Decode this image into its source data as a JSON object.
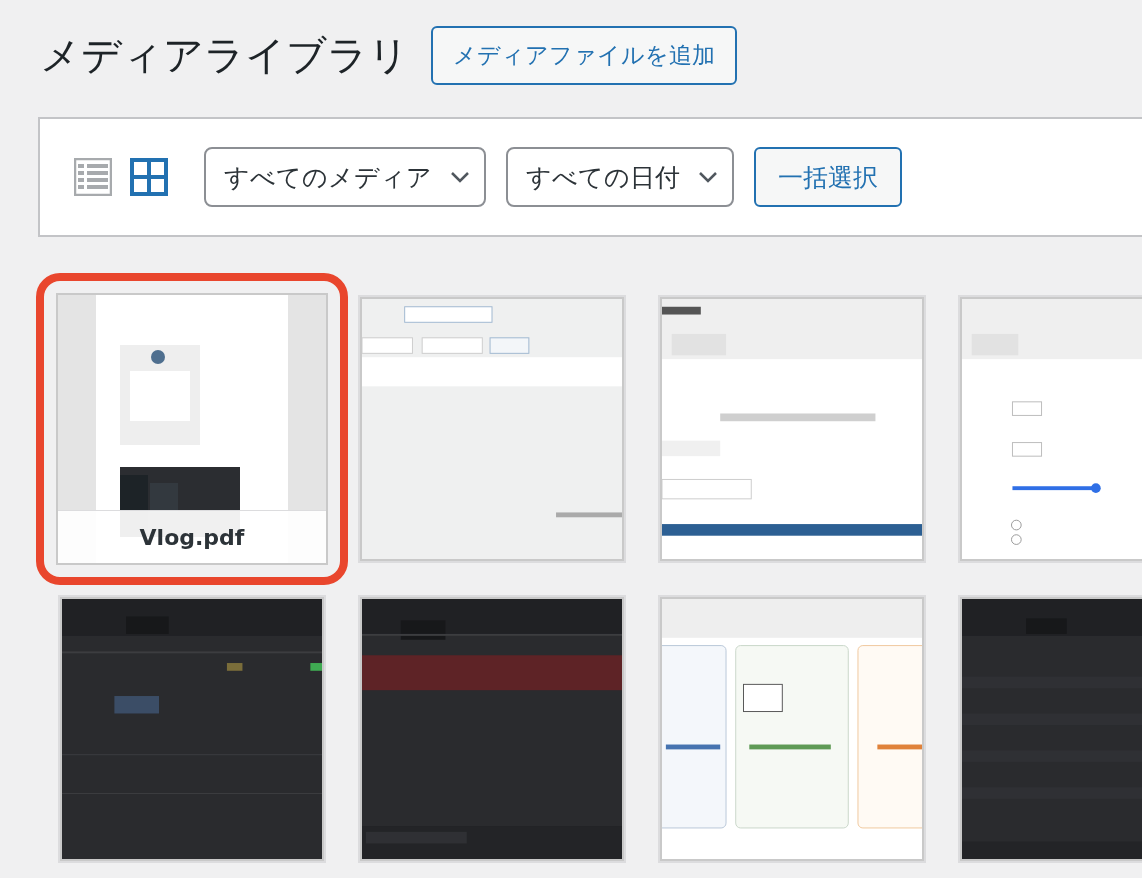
{
  "page": {
    "title": "メディアライブラリ",
    "add_button": "メディアファイルを追加"
  },
  "toolbar": {
    "views": [
      {
        "kind": "list",
        "selected": false
      },
      {
        "kind": "grid",
        "selected": true
      }
    ],
    "filters": [
      {
        "value": "すべてのメディア"
      },
      {
        "value": "すべての日付"
      }
    ],
    "bulk_button": "一括選択"
  },
  "items": [
    {
      "kind": "picture",
      "selected": true,
      "filename": "Vlog.pdf"
    },
    {
      "kind": "picture",
      "selected": false
    },
    {
      "kind": "picture",
      "selected": false
    },
    {
      "kind": "picture",
      "selected": false
    },
    {
      "kind": "picture",
      "selected": false
    },
    {
      "kind": "picture",
      "selected": false
    },
    {
      "kind": "picture",
      "selected": false
    },
    {
      "kind": "picture",
      "selected": false
    }
  ]
}
